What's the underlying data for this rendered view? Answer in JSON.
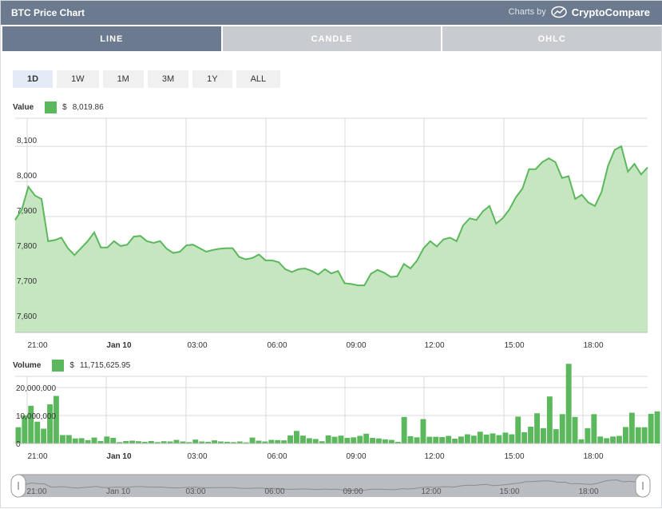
{
  "header": {
    "title": "BTC Price Chart",
    "credit": "Charts by",
    "brand": "CryptoCompare"
  },
  "tabs": [
    {
      "label": "LINE",
      "active": true
    },
    {
      "label": "CANDLE",
      "active": false
    },
    {
      "label": "OHLC",
      "active": false
    }
  ],
  "ranges": [
    {
      "label": "1D",
      "active": true
    },
    {
      "label": "1W"
    },
    {
      "label": "1M"
    },
    {
      "label": "3M"
    },
    {
      "label": "1Y"
    },
    {
      "label": "ALL"
    }
  ],
  "value_legend": {
    "label": "Value",
    "currency": "$",
    "amount": "8,019.86"
  },
  "volume_legend": {
    "label": "Volume",
    "currency": "$",
    "amount": "11,715,625.95"
  },
  "colors": {
    "line": "#5cb85c",
    "fill": "#c5e6c0",
    "bar": "#5cb85c",
    "header": "#6b7a8f"
  },
  "chart_data": [
    {
      "type": "area",
      "title": "",
      "y_ticks": [
        "7,600",
        "7,700",
        "7,800",
        "7,900",
        "8,000",
        "8,100"
      ],
      "ylim": [
        7570,
        8180
      ],
      "x_ticks": [
        "21:00",
        "Jan 10",
        "03:00",
        "06:00",
        "09:00",
        "12:00",
        "15:00",
        "18:00"
      ],
      "grid": true,
      "series": [
        {
          "values": [
            7890,
            7920,
            7985,
            7960,
            7950,
            7830,
            7833,
            7840,
            7810,
            7790,
            7810,
            7830,
            7855,
            7812,
            7812,
            7830,
            7816,
            7820,
            7843,
            7845,
            7830,
            7825,
            7830,
            7808,
            7796,
            7800,
            7818,
            7820,
            7810,
            7800,
            7805,
            7808,
            7810,
            7810,
            7785,
            7778,
            7782,
            7792,
            7775,
            7775,
            7770,
            7750,
            7742,
            7750,
            7752,
            7745,
            7735,
            7750,
            7738,
            7745,
            7710,
            7708,
            7704,
            7704,
            7737,
            7748,
            7740,
            7728,
            7730,
            7765,
            7752,
            7775,
            7810,
            7830,
            7815,
            7835,
            7840,
            7830,
            7875,
            7895,
            7890,
            7915,
            7930,
            7880,
            7895,
            7920,
            7955,
            7980,
            8035,
            8035,
            8055,
            8066,
            8055,
            8010,
            8015,
            7950,
            7962,
            7940,
            7930,
            7970,
            8045,
            8090,
            8100,
            8028,
            8050,
            8020,
            8040
          ]
        }
      ]
    },
    {
      "type": "bar",
      "title": "",
      "y_ticks": [
        "0",
        "10,000,000",
        "20,000,000"
      ],
      "ylim": [
        0,
        24000000
      ],
      "x_ticks": [
        "21:00",
        "Jan 10",
        "03:00",
        "06:00",
        "09:00",
        "12:00",
        "15:00",
        "18:00"
      ],
      "grid": true,
      "series": [
        {
          "name": "Volume",
          "values": [
            5800000,
            10000000,
            13500000,
            7800000,
            5300000,
            14000000,
            17000000,
            3000000,
            3000000,
            1800000,
            1900000,
            1200000,
            2100000,
            900000,
            2500000,
            2000000,
            500000,
            900000,
            1000000,
            800000,
            600000,
            900000,
            500000,
            800000,
            700000,
            1300000,
            700000,
            500000,
            1400000,
            700000,
            600000,
            1100000,
            700000,
            600000,
            500000,
            700000,
            400000,
            2100000,
            1000000,
            700000,
            1300000,
            1200000,
            1100000,
            2900000,
            4500000,
            2800000,
            1900000,
            1600000,
            800000,
            2900000,
            2400000,
            2800000,
            2000000,
            2200000,
            2700000,
            3500000,
            2000000,
            1800000,
            1500000,
            1300000,
            600000,
            9500000,
            2600000,
            2200000,
            8700000,
            2400000,
            2400000,
            2300000,
            2700000,
            1700000,
            2500000,
            3300000,
            2800000,
            4200000,
            3200000,
            3600000,
            3000000,
            3900000,
            3300000,
            9600000,
            4000000,
            6000000,
            10800000,
            5500000,
            16800000,
            5100000,
            10500000,
            28500000,
            9500000,
            1500000,
            5500000,
            10500000,
            2500000,
            1900000,
            2500000,
            2700000,
            5900000,
            11000000,
            5800000,
            5800000,
            10600000,
            11500000
          ]
        }
      ]
    }
  ],
  "navigator": {
    "labels": [
      "21:00",
      "Jan 10",
      "03:00",
      "06:00",
      "09:00",
      "12:00",
      "15:00",
      "18:00"
    ]
  }
}
